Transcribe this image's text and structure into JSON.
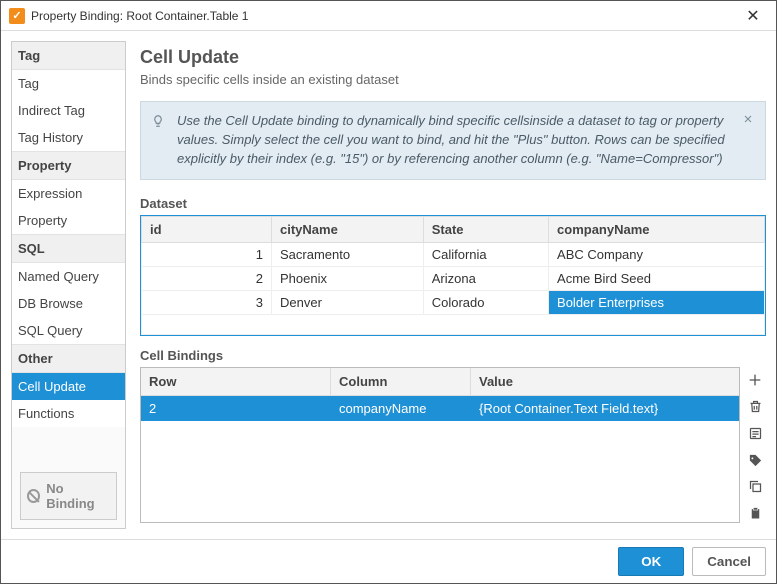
{
  "window": {
    "title": "Property Binding: Root Container.Table 1"
  },
  "sidebar": {
    "groups": [
      {
        "label": "Tag",
        "items": [
          {
            "label": "Tag"
          },
          {
            "label": "Indirect Tag"
          },
          {
            "label": "Tag History"
          }
        ]
      },
      {
        "label": "Property",
        "items": [
          {
            "label": "Expression"
          },
          {
            "label": "Property"
          }
        ]
      },
      {
        "label": "SQL",
        "items": [
          {
            "label": "Named Query"
          },
          {
            "label": "DB Browse"
          },
          {
            "label": "SQL Query"
          }
        ]
      },
      {
        "label": "Other",
        "items": [
          {
            "label": "Cell Update",
            "selected": true
          },
          {
            "label": "Functions"
          }
        ]
      }
    ],
    "no_binding": "No Binding"
  },
  "main": {
    "heading": "Cell Update",
    "subtitle": "Binds specific cells inside an existing dataset",
    "tip_pre": "Use the ",
    "tip_em": "Cell Update",
    "tip_post": " binding to dynamically bind specific cellsinside a dataset to tag or property values. Simply select the cell you want to bind, and hit the \"Plus\" button. Rows can be specified explicitly by their index (e.g. \"15\") or by referencing another column (e.g. \"Name=Compressor\")",
    "dataset_label": "Dataset",
    "dataset": {
      "columns": [
        "id",
        "cityName",
        "State",
        "companyName"
      ],
      "rows": [
        {
          "id": "1",
          "cityName": "Sacramento",
          "State": "California",
          "companyName": "ABC Company"
        },
        {
          "id": "2",
          "cityName": "Phoenix",
          "State": "Arizona",
          "companyName": "Acme Bird Seed"
        },
        {
          "id": "3",
          "cityName": "Denver",
          "State": "Colorado",
          "companyName": "Bolder Enterprises"
        }
      ],
      "selected_cell": {
        "row_index": 2,
        "col": "companyName"
      }
    },
    "bindings_label": "Cell Bindings",
    "bindings": {
      "columns": [
        "Row",
        "Column",
        "Value"
      ],
      "rows": [
        {
          "Row": "2",
          "Column": "companyName",
          "Value": "{Root Container.Text Field.text}"
        }
      ]
    }
  },
  "footer": {
    "ok": "OK",
    "cancel": "Cancel"
  }
}
